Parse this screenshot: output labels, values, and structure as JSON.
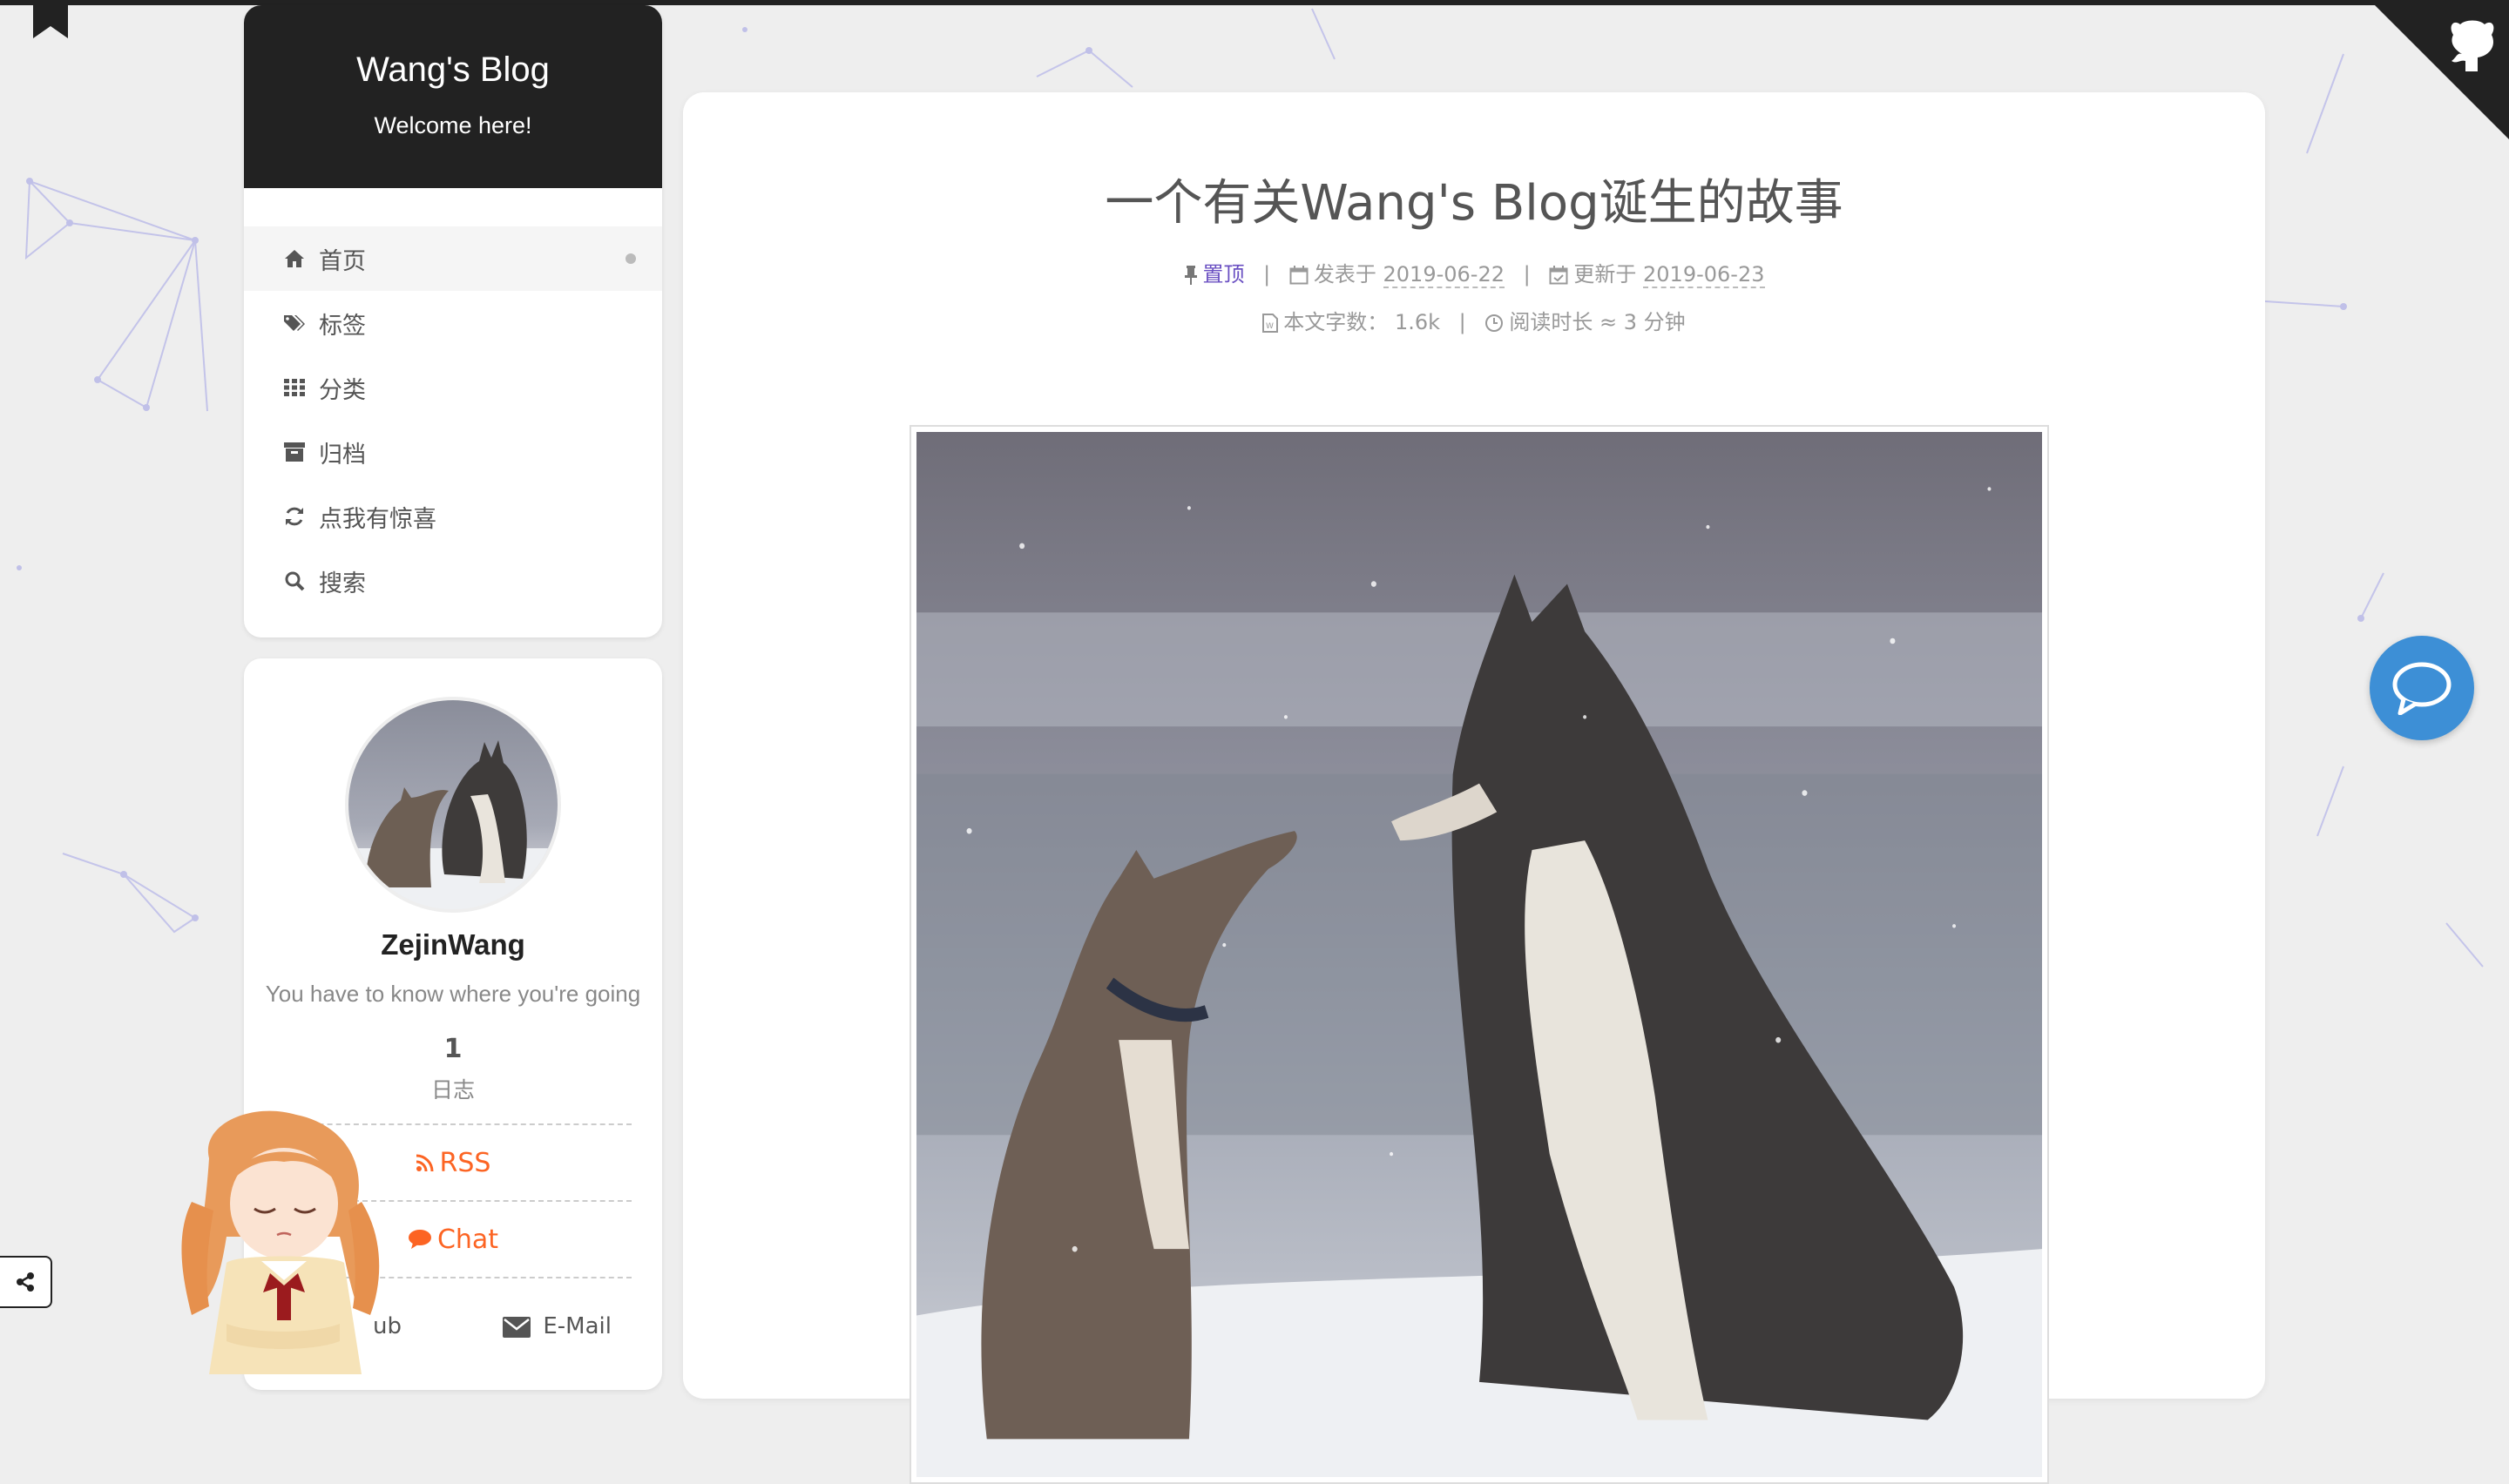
{
  "site": {
    "title": "Wang's Blog",
    "subtitle": "Welcome here!"
  },
  "menu": {
    "items": [
      {
        "label": "首页",
        "icon": "home-icon",
        "active": true
      },
      {
        "label": "标签",
        "icon": "tags-icon"
      },
      {
        "label": "分类",
        "icon": "th-icon"
      },
      {
        "label": "归档",
        "icon": "archive-icon"
      },
      {
        "label": "点我有惊喜",
        "icon": "refresh-icon"
      },
      {
        "label": "搜索",
        "icon": "search-icon"
      }
    ]
  },
  "author": {
    "name": "ZejinWang",
    "description": "You have to know where you're going",
    "posts_count": "1",
    "posts_label": "日志",
    "rss_label": "RSS",
    "chat_label": "Chat",
    "github_label": "ub",
    "email_label": "E-Mail"
  },
  "post": {
    "title": "一个有关Wang's Blog诞生的故事",
    "pinned_label": "置顶",
    "published_label": "发表于",
    "published_date": "2019-06-22",
    "updated_label": "更新于",
    "updated_date": "2019-06-23",
    "wordcount_label": "本文字数：",
    "wordcount": "1.6k",
    "readtime_label": "阅读时长 ≈",
    "readtime": "3 分钟",
    "separator": "|"
  },
  "colors": {
    "accent": "#fc6423",
    "header_bg": "#222222",
    "pin": "#6a4fc2",
    "chat_bubble": "#3d8fd6",
    "background": "#eeeeee"
  }
}
